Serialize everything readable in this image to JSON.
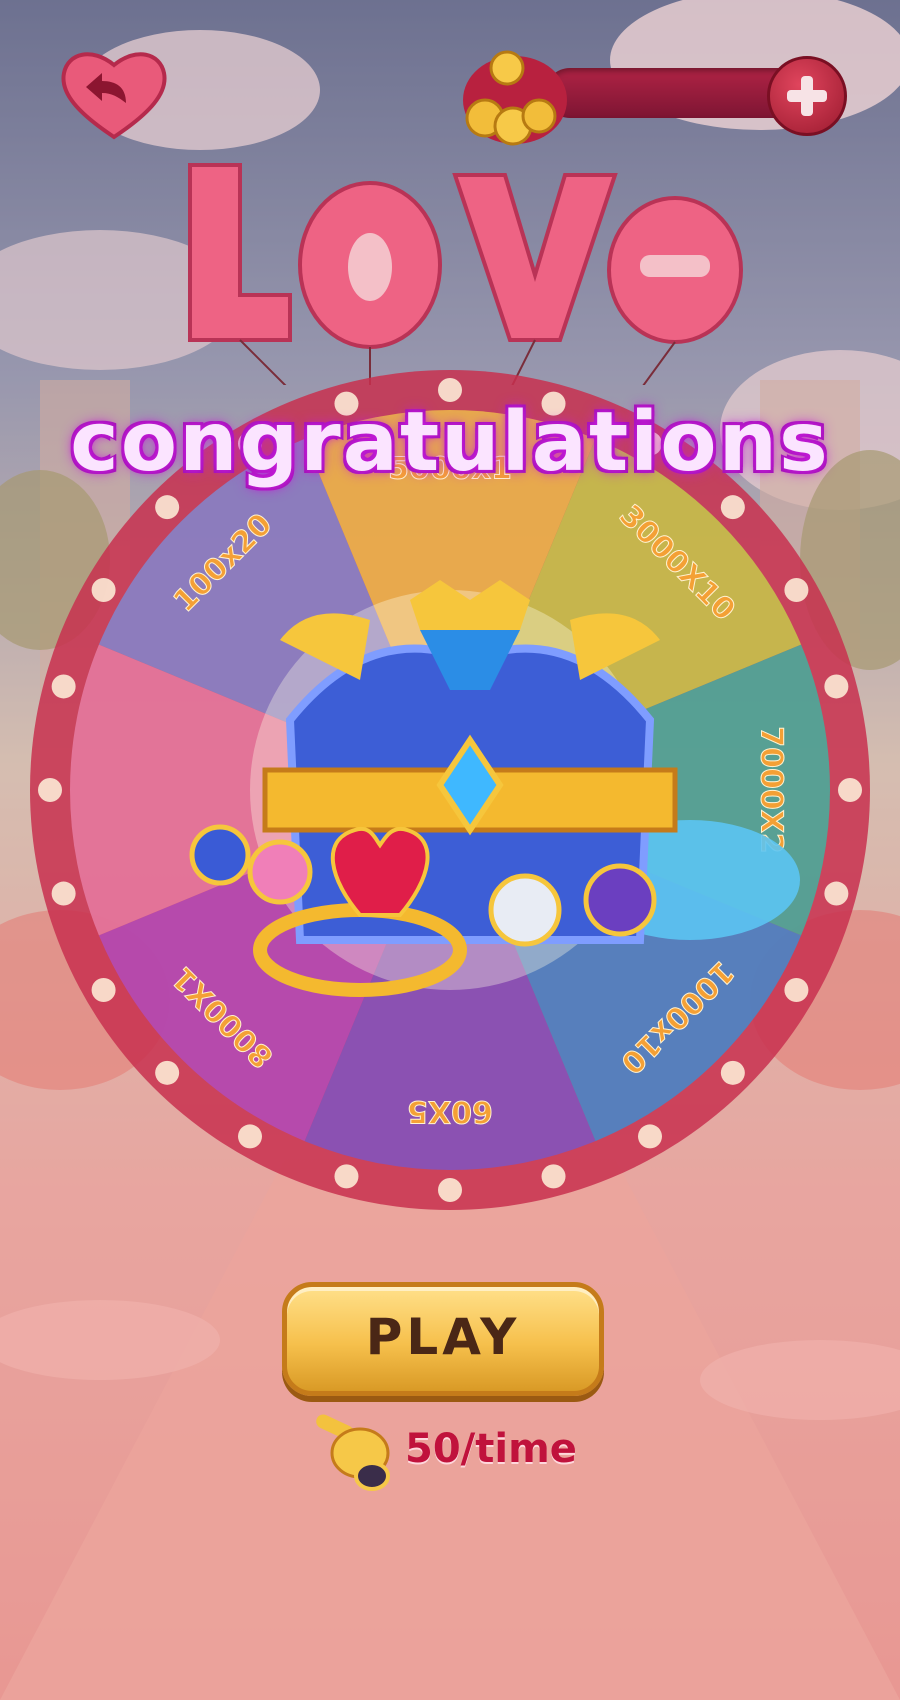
{
  "title_art": "LOVE",
  "message": "congratulations",
  "coins": {
    "value": ""
  },
  "wheel": {
    "segments": [
      {
        "label": "100x20",
        "color": "#7e8bd6"
      },
      {
        "label": "5000x1",
        "color": "#f0c34a"
      },
      {
        "label": "3000X10",
        "color": "#c6d24a"
      },
      {
        "label": "7000X2",
        "color": "#3bb7a3"
      },
      {
        "label": "1000x10",
        "color": "#3a8fd4"
      },
      {
        "label": "60X5",
        "color": "#7a55c8"
      },
      {
        "label": "8000X1",
        "color": "#b04cc0"
      },
      {
        "label": "",
        "color": "#e87fa8"
      }
    ],
    "rim_color": "#e03c63"
  },
  "play_button": {
    "label": "PLAY"
  },
  "cost": {
    "label": "50/time"
  },
  "icons": [
    "back-heart-icon",
    "coin-bag-icon",
    "plus-icon",
    "treasure-chest-icon",
    "pointing-hand-icon"
  ]
}
